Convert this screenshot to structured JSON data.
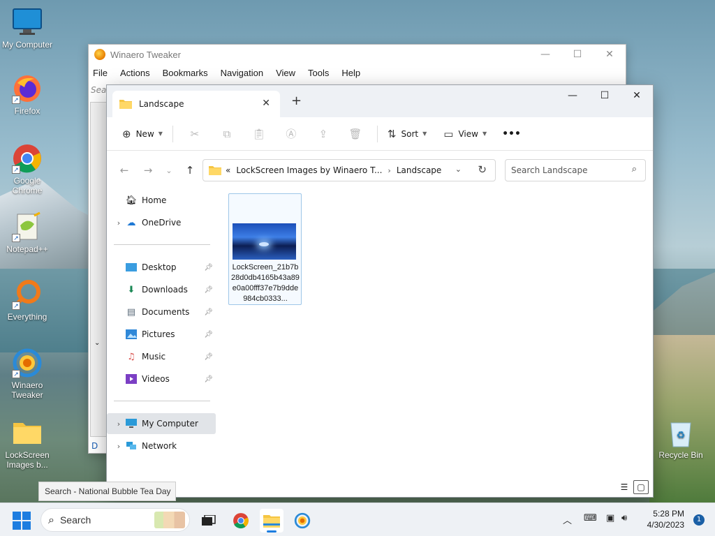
{
  "desktop": {
    "icons": [
      {
        "label": "My Computer"
      },
      {
        "label": "Firefox"
      },
      {
        "label": "Google Chrome"
      },
      {
        "label": "Notepad++"
      },
      {
        "label": "Everything"
      },
      {
        "label": "Winaero Tweaker"
      },
      {
        "label": "LockScreen Images b..."
      },
      {
        "label": "Recycle Bin"
      }
    ]
  },
  "tweaker": {
    "title": "Winaero Tweaker",
    "menu": [
      "File",
      "Actions",
      "Bookmarks",
      "Navigation",
      "View",
      "Tools",
      "Help"
    ],
    "search_placeholder": "Sear",
    "bottom_link": "D"
  },
  "explorer": {
    "tab_title": "Landscape",
    "toolbar": {
      "new_label": "New",
      "sort_label": "Sort",
      "view_label": "View",
      "more_label": "•••"
    },
    "address": {
      "overflow": "«",
      "crumbs": [
        "LockScreen Images by Winaero T...",
        "Landscape"
      ]
    },
    "search_placeholder": "Search Landscape",
    "nav": {
      "home": "Home",
      "onedrive": "OneDrive",
      "desktop": "Desktop",
      "downloads": "Downloads",
      "documents": "Documents",
      "pictures": "Pictures",
      "music": "Music",
      "videos": "Videos",
      "my_computer": "My Computer",
      "network": "Network"
    },
    "files": [
      {
        "name": "LockScreen_21b7b28d0db4165b43a89e0a00fff37e7b9dde984cb0333..."
      }
    ]
  },
  "tooltip": "Search - National Bubble Tea Day",
  "taskbar": {
    "search_label": "Search",
    "time": "5:28 PM",
    "date": "4/30/2023",
    "notification_count": "1"
  },
  "colors": {
    "accent": "#1d7de0",
    "selection": "#e1e4e8"
  }
}
